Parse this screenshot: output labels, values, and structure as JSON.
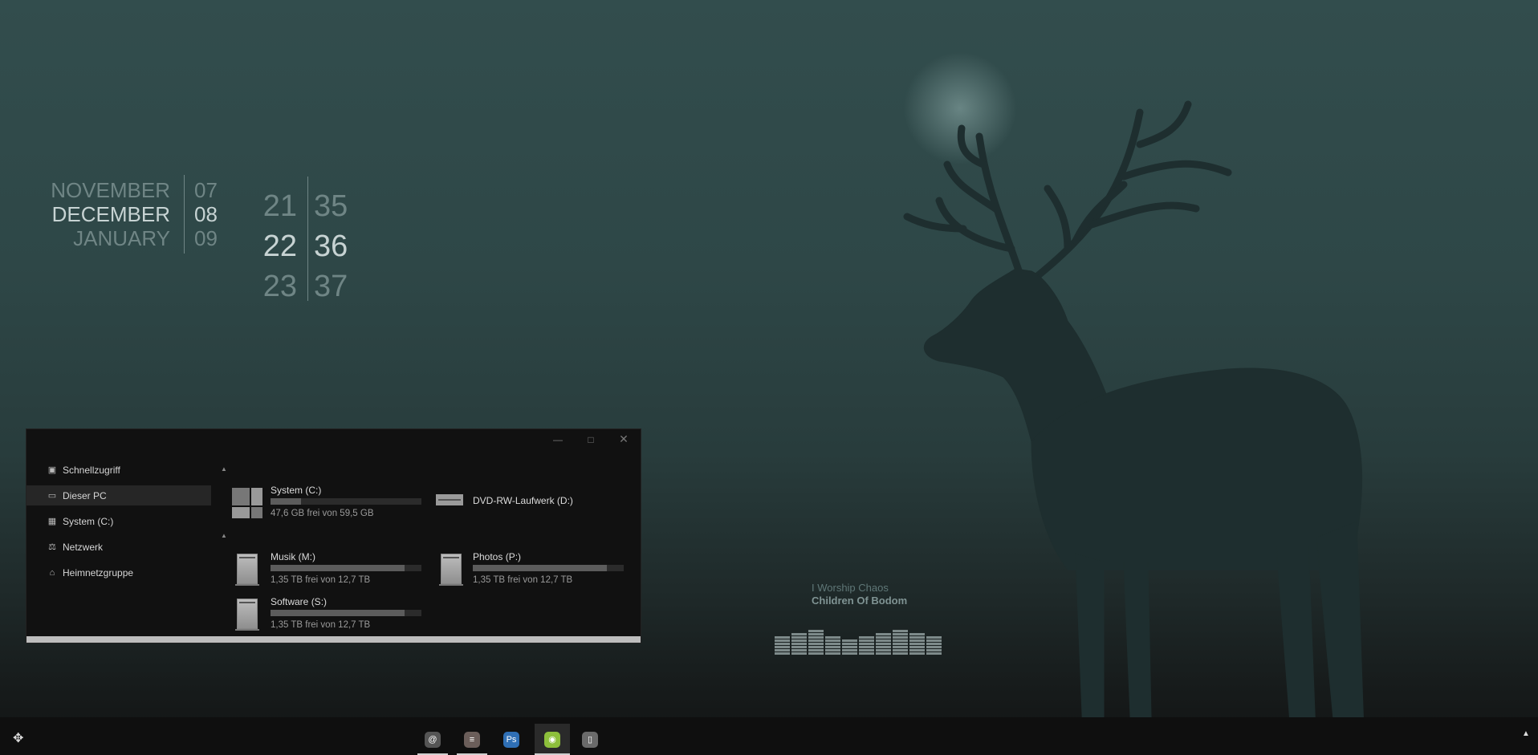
{
  "date": {
    "months": [
      "NOVEMBER",
      "DECEMBER",
      "JANUARY"
    ],
    "days": [
      "07",
      "08",
      "09"
    ]
  },
  "clock": {
    "hours": [
      "21",
      "22",
      "23"
    ],
    "minutes": [
      "35",
      "36",
      "37"
    ]
  },
  "explorer": {
    "sidebar": [
      {
        "label": "Schnellzugriff",
        "icon": "quick-access-icon"
      },
      {
        "label": "Dieser PC",
        "icon": "pc-icon"
      },
      {
        "label": "System (C:)",
        "icon": "drive-icon"
      },
      {
        "label": "Netzwerk",
        "icon": "network-icon"
      },
      {
        "label": "Heimnetzgruppe",
        "icon": "homegroup-icon"
      }
    ],
    "drives": [
      {
        "name": "System (C:)",
        "free": "47,6 GB frei von 59,5 GB",
        "used_fraction": 0.2
      },
      {
        "name": "DVD-RW-Laufwerk (D:)"
      },
      {
        "name": "Musik (M:)",
        "free": "1,35 TB frei von 12,7 TB",
        "used_fraction": 0.89
      },
      {
        "name": "Photos (P:)",
        "free": "1,35 TB frei von 12,7 TB",
        "used_fraction": 0.89
      },
      {
        "name": "Software (S:)",
        "free": "1,35 TB frei von 12,7 TB",
        "used_fraction": 0.89
      }
    ]
  },
  "music": {
    "track": "I Worship Chaos",
    "artist": "Children Of Bodom",
    "levels": [
      0.5,
      0.65,
      0.75,
      0.58,
      0.45,
      0.5,
      0.6,
      0.7,
      0.62,
      0.5
    ]
  },
  "taskbar": {
    "apps": [
      {
        "name": "browser-app",
        "glyph": "@",
        "color": "#555555"
      },
      {
        "name": "settings-app",
        "glyph": "≡",
        "color": "#6b5e5a"
      },
      {
        "name": "photoshop-app",
        "glyph": "Ps",
        "color": "#2f6fb5"
      },
      {
        "name": "spotify-app",
        "glyph": "◉",
        "color": "#8dbf3b"
      },
      {
        "name": "files-app",
        "glyph": "▯",
        "color": "#6a6a6a"
      }
    ]
  }
}
